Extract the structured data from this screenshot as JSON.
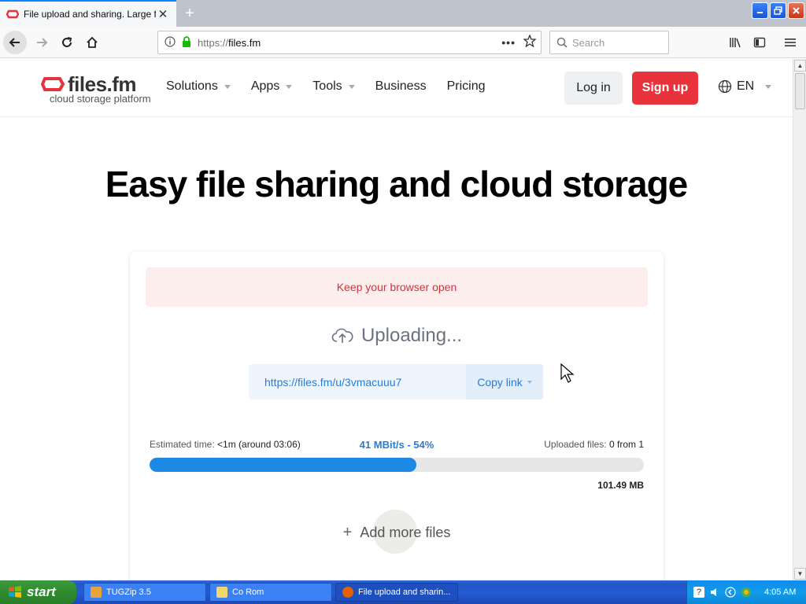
{
  "browser": {
    "tab_title": "File upload and sharing. Large file",
    "tab_close": "✕",
    "new_tab": "+",
    "url_protocol": "https://",
    "url_host": "files.fm",
    "search_placeholder": "Search"
  },
  "site": {
    "logo_main": "files.fm",
    "logo_sub": "cloud storage platform",
    "menu": [
      {
        "label": "Solutions",
        "dropdown": true
      },
      {
        "label": "Apps",
        "dropdown": true
      },
      {
        "label": "Tools",
        "dropdown": true
      },
      {
        "label": "Business",
        "dropdown": false
      },
      {
        "label": "Pricing",
        "dropdown": false
      }
    ],
    "login_label": "Log in",
    "signup_label": "Sign up",
    "language": "EN",
    "accent_color": "#e8323c"
  },
  "hero_title": "Easy file sharing and cloud storage",
  "upload": {
    "alert": "Keep your browser open",
    "status": "Uploading...",
    "link": "https://files.fm/u/3vmacuuu7",
    "copy_label": "Copy link",
    "est_label": "Estimated time:",
    "est_value": "<1m (around 03:06)",
    "speed": "41 MBit/s - 54%",
    "progress_fraction": 0.54,
    "uploaded_label": "Uploaded files:",
    "uploaded_value": "0 from 1",
    "size": "101.49 MB",
    "add_more": "Add more files",
    "progress_color": "#1e88e5"
  },
  "taskbar": {
    "start": "start",
    "tasks": [
      {
        "label": "TUGZip 3.5",
        "active": false
      },
      {
        "label": "Co Rom",
        "active": false
      },
      {
        "label": "File upload and sharin...",
        "active": true
      }
    ],
    "clock": "4:05 AM"
  }
}
